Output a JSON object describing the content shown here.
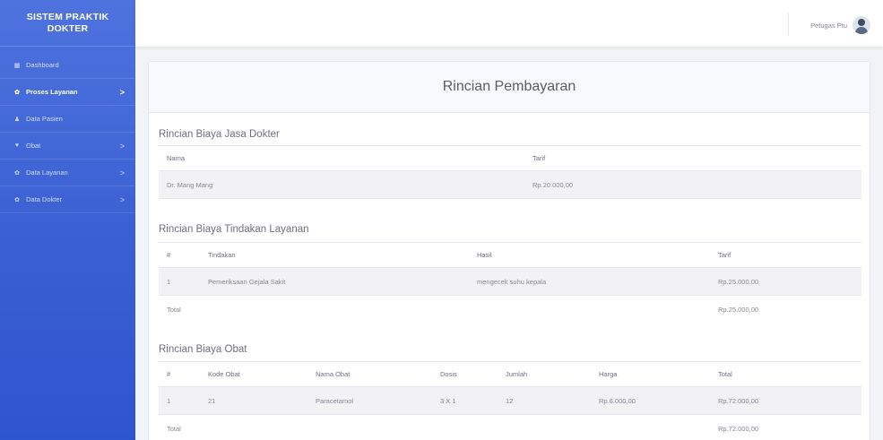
{
  "app": {
    "brand_line1": "SISTEM PRAKTIK",
    "brand_line2": "DOKTER"
  },
  "sidebar": {
    "items": [
      {
        "label": "Dashboard",
        "icon": "dashboard-icon"
      },
      {
        "label": "Proses Layanan",
        "icon": "cog-icon",
        "active": true,
        "chevron": ">"
      },
      {
        "label": "Data Pasien",
        "icon": "user-icon"
      },
      {
        "label": "Obat",
        "icon": "pill-icon",
        "chevron": ">"
      },
      {
        "label": "Data Layanan",
        "icon": "cog-icon",
        "chevron": ">"
      },
      {
        "label": "Data Dokter",
        "icon": "cog-icon",
        "chevron": ">"
      }
    ]
  },
  "topbar": {
    "user_name": "Petugas Ptu"
  },
  "page": {
    "title": "Rincian Pembayaran"
  },
  "dokter_section": {
    "title": "Rincian Biaya Jasa Dokter",
    "headers": [
      "Nama",
      "Tarif"
    ],
    "rows": [
      [
        "Dr. Mang Mang",
        "Rp.20.000,00"
      ]
    ]
  },
  "tindakan_section": {
    "title": "Rincian Biaya Tindakan Layanan",
    "headers": [
      "#",
      "Tindakan",
      "Hasil",
      "Tarif"
    ],
    "rows": [
      [
        "1",
        "Pemeriksaan Gejala Sakit",
        "mengecek suhu kepala",
        "Rp.25.000,00"
      ]
    ],
    "total_label": "Total",
    "total_value": "Rp.25.000,00"
  },
  "obat_section": {
    "title": "Rincian Biaya Obat",
    "headers": [
      "#",
      "Kode Obat",
      "Nama Obat",
      "Dosis",
      "Jumlah",
      "Harga",
      "Total"
    ],
    "rows": [
      [
        "1",
        "21",
        "Paracetamol",
        "3 X 1",
        "12",
        "Rp.6.000,00",
        "Rp.72.000,00"
      ]
    ],
    "total_label": "Total",
    "total_value": "Rp.72.000,00"
  },
  "colors": {
    "sidebar": "#4e73df",
    "text": "#858796"
  }
}
